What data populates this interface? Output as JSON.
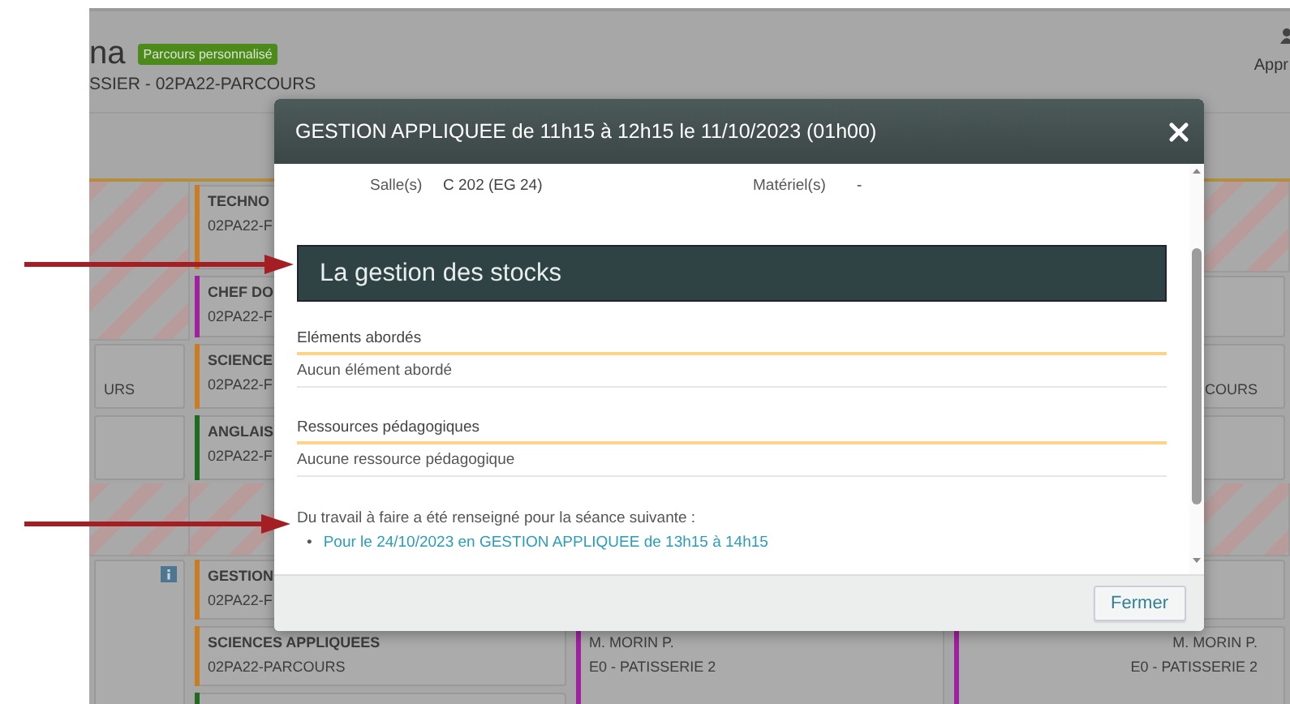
{
  "backdrop": {
    "header": {
      "name": "na",
      "badge": "Parcours personnalisé",
      "class_line": "SSIER - 02PA22-PARCOURS",
      "right_label": "Appr"
    },
    "schedule": {
      "columns": [
        {
          "items": [
            {
              "kind": "hatched"
            },
            {
              "kind": "card",
              "lines": [
                "URS"
              ],
              "info": false
            },
            {
              "kind": "card",
              "info": false
            },
            {
              "kind": "hatched"
            },
            {
              "kind": "card",
              "info": true
            }
          ]
        },
        {
          "items": [
            {
              "kind": "card",
              "title": "TECHNO",
              "lines": [
                "02PA22-F"
              ],
              "color": "#c97d20",
              "info": false
            },
            {
              "kind": "card",
              "title": "CHEF DO",
              "lines": [
                "02PA22-F"
              ],
              "color": "#a020a0",
              "info": false
            },
            {
              "kind": "card",
              "title": "SCIENCE",
              "lines": [
                "02PA22-F"
              ],
              "color": "#c97d20",
              "info": false
            },
            {
              "kind": "card",
              "title": "ANGLAIS",
              "lines": [
                "02PA22-F"
              ],
              "color": "#1f6a1f",
              "info": false
            },
            {
              "kind": "hatched"
            },
            {
              "kind": "card",
              "title": "GESTION",
              "lines": [
                "02PA22-F"
              ],
              "color": "#c97d20",
              "info": false
            },
            {
              "kind": "card",
              "title": "SCIENCES APPLIQUEES",
              "lines": [
                "02PA22-PARCOURS"
              ],
              "color": "#c97d20",
              "info": false
            },
            {
              "kind": "card",
              "color": "#1f6a1f",
              "info": false
            }
          ]
        },
        {
          "items": [
            {
              "kind": "empty"
            },
            {
              "kind": "card",
              "lines": [
                "M. MORIN P.",
                "E0 - PATISSERIE 2"
              ],
              "color": "#a020a0",
              "info": false
            }
          ]
        },
        {
          "items": [
            {
              "kind": "hatched"
            },
            {
              "kind": "card",
              "info": false
            },
            {
              "kind": "card",
              "lines": [
                "COURS"
              ],
              "info": false
            },
            {
              "kind": "card",
              "info": false
            },
            {
              "kind": "hatched"
            },
            {
              "kind": "card",
              "info": false
            },
            {
              "kind": "card",
              "lines": [
                "M. MORIN P.",
                "E0 - PATISSERIE 2"
              ],
              "color": "#a020a0",
              "info": false
            }
          ]
        }
      ]
    }
  },
  "modal": {
    "title": "GESTION APPLIQUEE de 11h15 à 12h15 le 11/10/2023 (01h00)",
    "room_label": "Salle(s)",
    "room": "C 202 (EG 24)",
    "equipment_label": "Matériel(s)",
    "equipment": "-",
    "heading": "La gestion des stocks",
    "sections": [
      {
        "title": "Eléments abordés",
        "value": "Aucun élément abordé"
      },
      {
        "title": "Ressources pédagogiques",
        "value": "Aucune ressource pédagogique"
      }
    ],
    "homework": {
      "intro": "Du travail à faire a été renseigné pour la séance suivante :",
      "links": [
        {
          "marker": "•",
          "text": "Pour le 24/10/2023 en GESTION APPLIQUEE de 13h15 à 14h15"
        }
      ]
    },
    "buttons": [
      "Fermer"
    ]
  }
}
